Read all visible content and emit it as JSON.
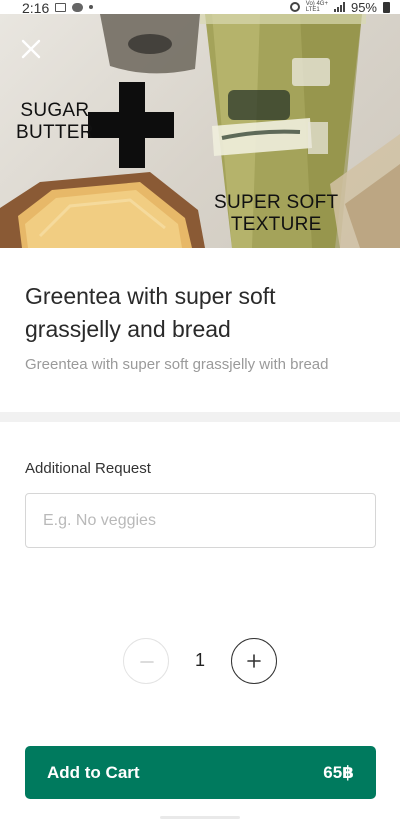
{
  "status_bar": {
    "time": "2:16",
    "battery": "95%",
    "network_top": "Vo) 4G+",
    "network_bottom": "LTE1"
  },
  "hero": {
    "close_icon": "close-icon",
    "overlay_left": [
      "SUGAR",
      "BUTTER"
    ],
    "overlay_right": [
      "SUPER SOFT",
      "TEXTURE"
    ]
  },
  "product": {
    "title": "Greentea with super soft grassjelly and bread",
    "description": "Greentea with super soft grassjelly with bread"
  },
  "request": {
    "label": "Additional Request",
    "placeholder": "E.g. No veggies",
    "value": ""
  },
  "quantity": {
    "value": "1",
    "minus_icon": "minus-icon",
    "plus_icon": "plus-icon"
  },
  "cart": {
    "label": "Add to Cart",
    "price": "65฿"
  },
  "colors": {
    "accent": "#007a5e",
    "divider": "#f1f1f1"
  }
}
